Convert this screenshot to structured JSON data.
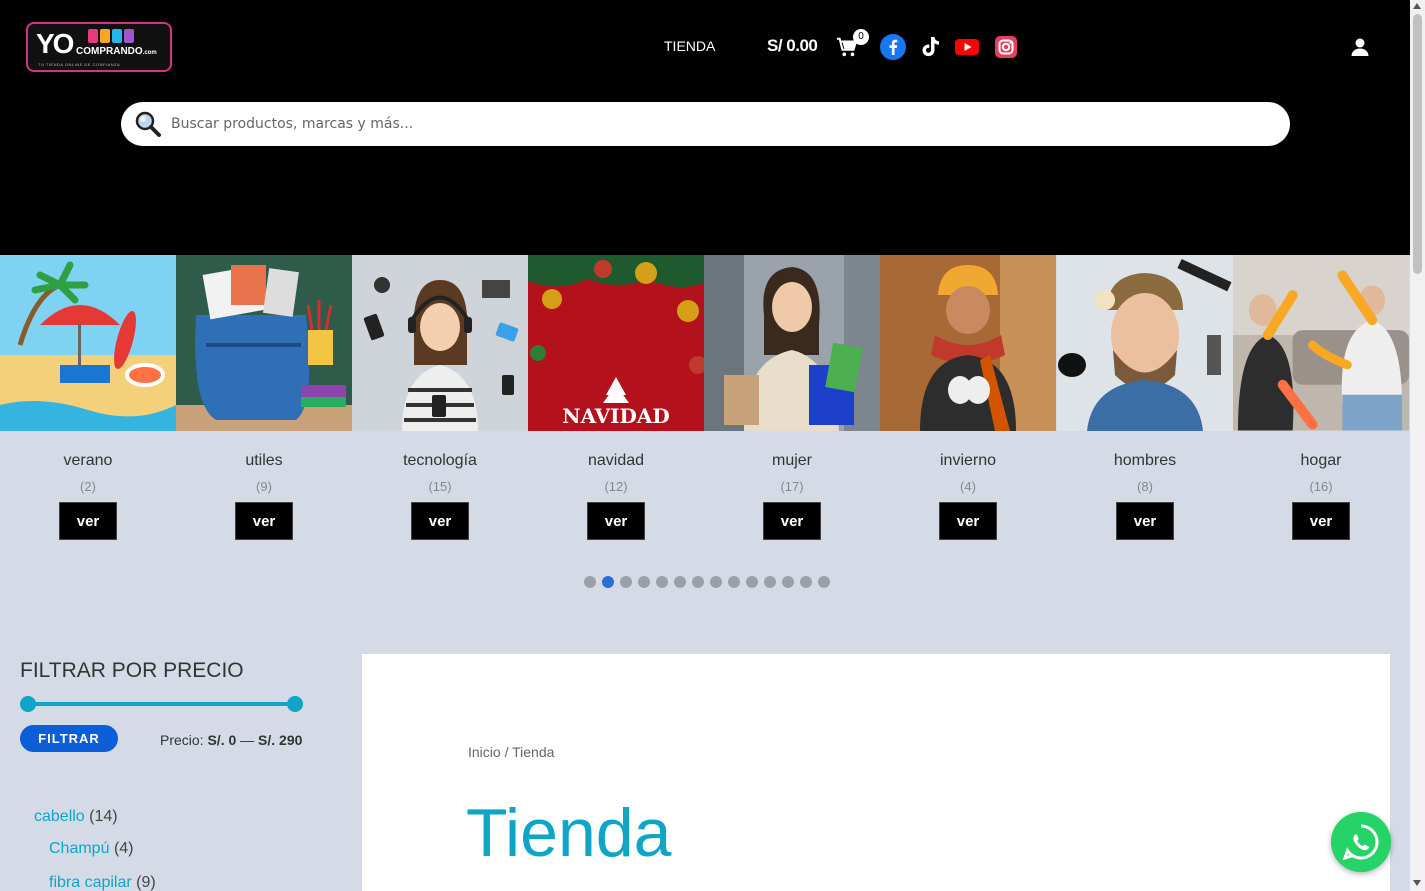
{
  "header": {
    "logo": {
      "yo": "YO",
      "comprando": "COMPRANDO",
      "com": ".com",
      "tagline": "TU TIENDA ONLINE DE CONFIANZA"
    },
    "nav_tienda": "TIENDA",
    "cart_total": "S/ 0.00",
    "cart_count": "0",
    "social": [
      "facebook-icon",
      "tiktok-icon",
      "youtube-icon",
      "instagram-icon"
    ],
    "search_placeholder": "Buscar productos, marcas y más..."
  },
  "categories": [
    {
      "name": "verano",
      "count": "(2)",
      "button": "ver"
    },
    {
      "name": "utiles",
      "count": "(9)",
      "button": "ver"
    },
    {
      "name": "tecnología",
      "count": "(15)",
      "button": "ver"
    },
    {
      "name": "navidad",
      "count": "(12)",
      "button": "ver",
      "image_text": "NAVIDAD"
    },
    {
      "name": "mujer",
      "count": "(17)",
      "button": "ver"
    },
    {
      "name": "invierno",
      "count": "(4)",
      "button": "ver"
    },
    {
      "name": "hombres",
      "count": "(8)",
      "button": "ver"
    },
    {
      "name": "hogar",
      "count": "(16)",
      "button": "ver"
    }
  ],
  "carousel": {
    "total_dots": 14,
    "active_index": 1
  },
  "sidebar": {
    "filter_title": "FILTRAR POR PRECIO",
    "filter_button": "FILTRAR",
    "price_prefix": "Precio:",
    "price_min": "S/. 0",
    "price_sep": "—",
    "price_max": "S/. 290",
    "category_list": [
      {
        "name": "cabello",
        "count": "(14)"
      },
      {
        "name": "Champú",
        "count": "(4)"
      },
      {
        "name": "fibra capilar",
        "count": "(9)"
      }
    ]
  },
  "main": {
    "breadcrumb_home": "Inicio",
    "breadcrumb_sep": "/",
    "breadcrumb_current": "Tienda",
    "title": "Tienda"
  },
  "colors": {
    "accent": "#0ea5c6",
    "button_blue": "#0b5ed7",
    "whatsapp": "#25d366",
    "header_bg": "#000000",
    "page_bg": "#d4dbe6"
  }
}
